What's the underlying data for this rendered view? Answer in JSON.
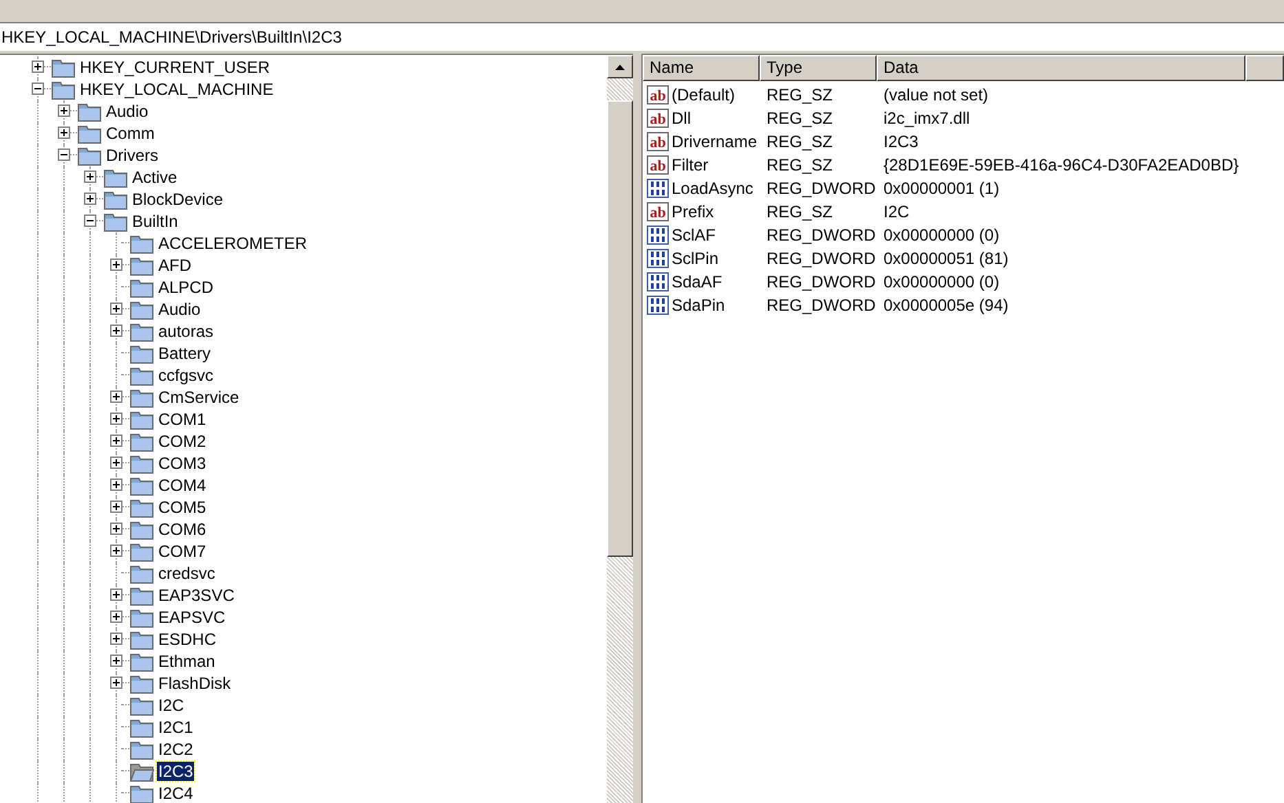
{
  "address_bar": {
    "value": "HKEY_LOCAL_MACHINE\\Drivers\\BuiltIn\\I2C3"
  },
  "tree": [
    {
      "label": "HKEY_CURRENT_USER",
      "kind": "branch",
      "expanded": false,
      "selected": false
    },
    {
      "label": "HKEY_LOCAL_MACHINE",
      "kind": "branch",
      "expanded": true,
      "selected": false,
      "children": [
        {
          "label": "Audio",
          "kind": "branch",
          "expanded": false,
          "selected": false
        },
        {
          "label": "Comm",
          "kind": "branch",
          "expanded": false,
          "selected": false
        },
        {
          "label": "Drivers",
          "kind": "branch",
          "expanded": true,
          "selected": false,
          "children": [
            {
              "label": "Active",
              "kind": "branch",
              "expanded": false,
              "selected": false
            },
            {
              "label": "BlockDevice",
              "kind": "branch",
              "expanded": false,
              "selected": false
            },
            {
              "label": "BuiltIn",
              "kind": "branch",
              "expanded": true,
              "selected": false,
              "children": [
                {
                  "label": "ACCELEROMETER",
                  "kind": "leaf",
                  "selected": false
                },
                {
                  "label": "AFD",
                  "kind": "branch",
                  "expanded": false,
                  "selected": false
                },
                {
                  "label": "ALPCD",
                  "kind": "leaf",
                  "selected": false
                },
                {
                  "label": "Audio",
                  "kind": "branch",
                  "expanded": false,
                  "selected": false
                },
                {
                  "label": "autoras",
                  "kind": "branch",
                  "expanded": false,
                  "selected": false
                },
                {
                  "label": "Battery",
                  "kind": "leaf",
                  "selected": false
                },
                {
                  "label": "ccfgsvc",
                  "kind": "leaf",
                  "selected": false
                },
                {
                  "label": "CmService",
                  "kind": "branch",
                  "expanded": false,
                  "selected": false
                },
                {
                  "label": "COM1",
                  "kind": "branch",
                  "expanded": false,
                  "selected": false
                },
                {
                  "label": "COM2",
                  "kind": "branch",
                  "expanded": false,
                  "selected": false
                },
                {
                  "label": "COM3",
                  "kind": "branch",
                  "expanded": false,
                  "selected": false
                },
                {
                  "label": "COM4",
                  "kind": "branch",
                  "expanded": false,
                  "selected": false
                },
                {
                  "label": "COM5",
                  "kind": "branch",
                  "expanded": false,
                  "selected": false
                },
                {
                  "label": "COM6",
                  "kind": "branch",
                  "expanded": false,
                  "selected": false
                },
                {
                  "label": "COM7",
                  "kind": "branch",
                  "expanded": false,
                  "selected": false
                },
                {
                  "label": "credsvc",
                  "kind": "leaf",
                  "selected": false
                },
                {
                  "label": "EAP3SVC",
                  "kind": "branch",
                  "expanded": false,
                  "selected": false
                },
                {
                  "label": "EAPSVC",
                  "kind": "branch",
                  "expanded": false,
                  "selected": false
                },
                {
                  "label": "ESDHC",
                  "kind": "branch",
                  "expanded": false,
                  "selected": false
                },
                {
                  "label": "Ethman",
                  "kind": "branch",
                  "expanded": false,
                  "selected": false
                },
                {
                  "label": "FlashDisk",
                  "kind": "branch",
                  "expanded": false,
                  "selected": false
                },
                {
                  "label": "I2C",
                  "kind": "leaf",
                  "selected": false
                },
                {
                  "label": "I2C1",
                  "kind": "leaf",
                  "selected": false
                },
                {
                  "label": "I2C2",
                  "kind": "leaf",
                  "selected": false
                },
                {
                  "label": "I2C3",
                  "kind": "leaf",
                  "selected": true
                },
                {
                  "label": "I2C4",
                  "kind": "leaf",
                  "selected": false
                }
              ]
            }
          ]
        }
      ]
    }
  ],
  "values_table": {
    "columns": [
      "Name",
      "Type",
      "Data"
    ],
    "rows": [
      {
        "kind": "string",
        "icon_text": "ab",
        "name": "(Default)",
        "type": "REG_SZ",
        "data": "(value not set)"
      },
      {
        "kind": "string",
        "icon_text": "ab",
        "name": "Dll",
        "type": "REG_SZ",
        "data": "i2c_imx7.dll"
      },
      {
        "kind": "string",
        "icon_text": "ab",
        "name": "Drivername",
        "type": "REG_SZ",
        "data": "I2C3"
      },
      {
        "kind": "string",
        "icon_text": "ab",
        "name": "Filter",
        "type": "REG_SZ",
        "data": "{28D1E69E-59EB-416a-96C4-D30FA2EAD0BD}"
      },
      {
        "kind": "binary",
        "name": "LoadAsync",
        "type": "REG_DWORD",
        "data": "0x00000001 (1)"
      },
      {
        "kind": "string",
        "icon_text": "ab",
        "name": "Prefix",
        "type": "REG_SZ",
        "data": "I2C"
      },
      {
        "kind": "binary",
        "name": "SclAF",
        "type": "REG_DWORD",
        "data": "0x00000000 (0)"
      },
      {
        "kind": "binary",
        "name": "SclPin",
        "type": "REG_DWORD",
        "data": "0x00000051 (81)"
      },
      {
        "kind": "binary",
        "name": "SdaAF",
        "type": "REG_DWORD",
        "data": "0x00000000 (0)"
      },
      {
        "kind": "binary",
        "name": "SdaPin",
        "type": "REG_DWORD",
        "data": "0x0000005e (94)"
      }
    ]
  }
}
